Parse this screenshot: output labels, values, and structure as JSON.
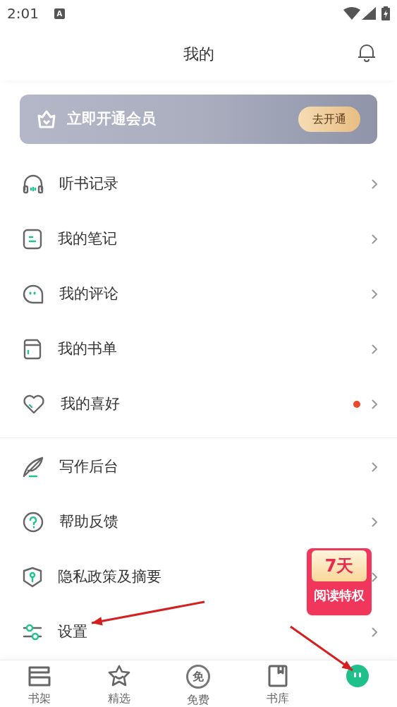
{
  "status_bar": {
    "time": "2:01",
    "badge": "A"
  },
  "header": {
    "title": "我的"
  },
  "vip_banner": {
    "text": "立即开通会员",
    "button": "去开通"
  },
  "menu_groups": [
    {
      "items": [
        {
          "kind": "headphones",
          "label": "听书记录",
          "dot": false
        },
        {
          "kind": "note",
          "label": "我的笔记",
          "dot": false
        },
        {
          "kind": "comment",
          "label": "我的评论",
          "dot": false
        },
        {
          "kind": "booklist",
          "label": "我的书单",
          "dot": false
        },
        {
          "kind": "heart",
          "label": "我的喜好",
          "dot": true
        }
      ]
    },
    {
      "items": [
        {
          "kind": "feather",
          "label": "写作后台",
          "dot": false
        },
        {
          "kind": "help",
          "label": "帮助反馈",
          "dot": false
        },
        {
          "kind": "shield",
          "label": "隐私政策及摘要",
          "dot": false
        },
        {
          "kind": "sliders",
          "label": "设置",
          "dot": false
        }
      ]
    }
  ],
  "promo_badge": {
    "days": "7天",
    "text": "阅读特权"
  },
  "tab_bar": [
    {
      "kind": "shelf",
      "label": "书架",
      "selected": false
    },
    {
      "kind": "star",
      "label": "精选",
      "selected": false
    },
    {
      "kind": "free",
      "label": "免费",
      "icon_text": "免",
      "selected": false
    },
    {
      "kind": "library",
      "label": "书库",
      "selected": false
    },
    {
      "kind": "face",
      "selected": true
    }
  ],
  "annotations": [
    {
      "kind": "arrow"
    },
    {
      "kind": "arrow"
    }
  ]
}
